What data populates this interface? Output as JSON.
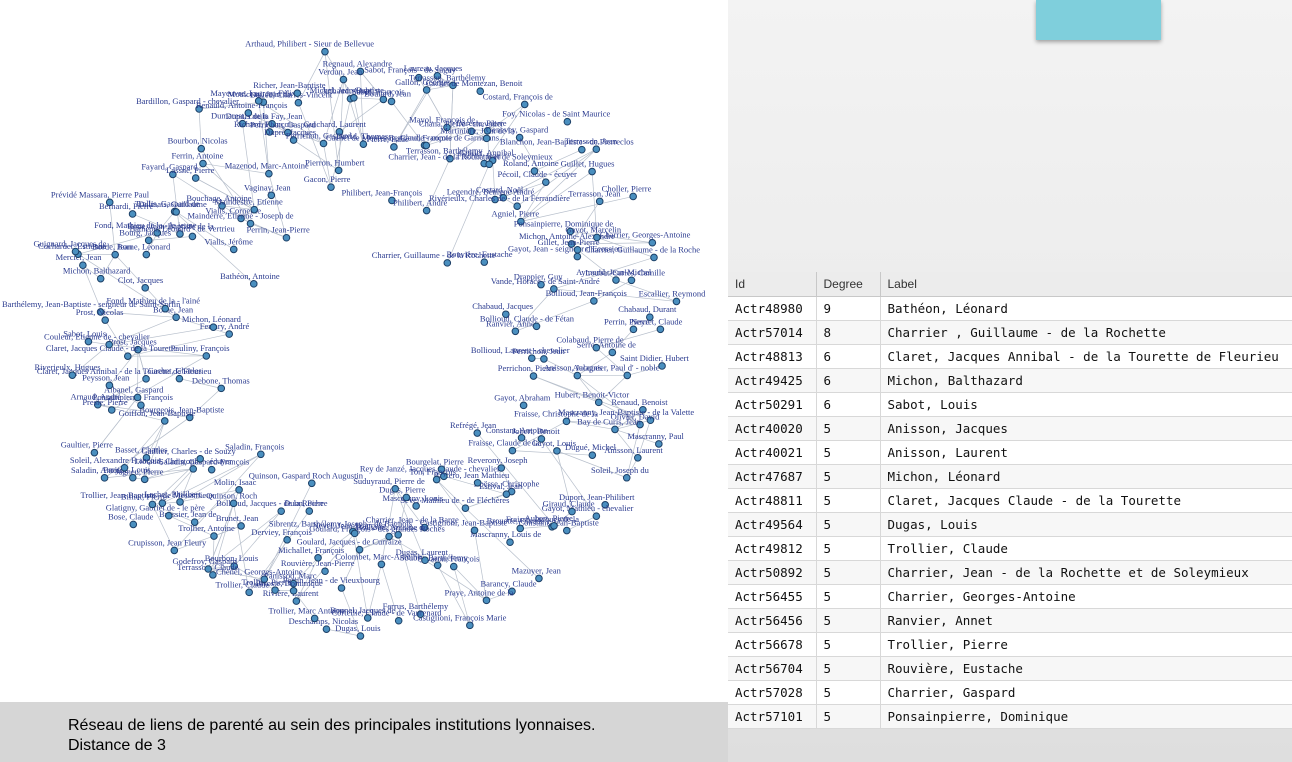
{
  "caption": {
    "line1": "Réseau de liens de parenté au sein des principales institutions lyonnaises.",
    "line2": "Distance de 3"
  },
  "table": {
    "headers": [
      "Id",
      "Degree",
      "Label"
    ],
    "rows": [
      [
        "Actr48980",
        "9",
        "Bathéon, Léonard"
      ],
      [
        "Actr57014",
        "8",
        "Charrier , Guillaume - de la Rochette"
      ],
      [
        "Actr48813",
        "6",
        "Claret, Jacques Annibal - de la Tourette de Fleurieu"
      ],
      [
        "Actr49425",
        "6",
        "Michon, Balthazard"
      ],
      [
        "Actr50291",
        "6",
        "Sabot, Louis"
      ],
      [
        "Actr40020",
        "5",
        "Anisson, Jacques"
      ],
      [
        "Actr40021",
        "5",
        "Anisson, Laurent"
      ],
      [
        "Actr47687",
        "5",
        "Michon, Léonard"
      ],
      [
        "Actr48811",
        "5",
        "Claret, Jacques Claude - de la Tourette"
      ],
      [
        "Actr49564",
        "5",
        "Dugas, Louis"
      ],
      [
        "Actr49812",
        "5",
        "Trollier, Claude"
      ],
      [
        "Actr50892",
        "5",
        "Charrier, Jean - de la Rochette et de Soleymieux"
      ],
      [
        "Actr56455",
        "5",
        "Charrier, Georges-Antoine"
      ],
      [
        "Actr56456",
        "5",
        "Ranvier, Annet"
      ],
      [
        "Actr56678",
        "5",
        "Trollier, Pierre"
      ],
      [
        "Actr56704",
        "5",
        "Rouvière, Eustache"
      ],
      [
        "Actr57028",
        "5",
        "Charrier, Gaspard"
      ],
      [
        "Actr57101",
        "5",
        "Ponsainpierre, Dominique"
      ]
    ]
  },
  "graph": {
    "node_labels": [
      "Regnaud, Alexandre",
      "Sabot, François",
      "Boulard, Jean",
      "Pierre, Isaac",
      "Philibert, Jean-François",
      "Sabot, François - de Sugny",
      "Gallon, Georges",
      "Laureau, Jacques",
      "Cachet de Montezan, Claude - comte de Garnerans",
      "Bertrand, François",
      "Terrasson, Barthélemy",
      "Mayol, François de",
      "Philibert, André",
      "Cachet de Montezan, Benoit",
      "Terrasson, Barthélemy",
      "Chana, Pierre - chevalier",
      "Martinière, Jean de la",
      "Dareste, Pierre",
      "Guillet, Annibal",
      "Fischer, Jean",
      "Costard, François de",
      "Charrier, Jean - de la Rochette et de Soleymieux",
      "Legendre, Bénigne André",
      "Genevey, Gaspard",
      "Foy, Nicolas - de Saint Maurice",
      "Costard, Noël",
      "Charrier, Guillaume - de la Rochette",
      "Pécoil, Claude - écuyer",
      "Rivérieulx, Charles de - de la Ferrandière",
      "Roland, Antoine",
      "Blanchon, Jean-Baptiste - de Pierreclos",
      "Terrasson, Jean",
      "Agniel, Pierre",
      "Guillet, Hugues",
      "Rouvière, Eustache",
      "Terrasson, Jean",
      "Choller, Pierre",
      "Ponsainpierre, Dominique de",
      "Michon, Antoine-Alexandre",
      "Gayot, Marcelin",
      "Gayot, Jean - seigneur d'Ecossieu",
      "Gillet, Jean-Pierre",
      "Charrier, Georges-Antoine",
      "Drappier, Guy",
      "Charrier, Guillaume - de la Roche",
      "Vande, Horace - de Saint-André",
      "Aymond, Jean-Michel",
      "Chabaud, Jacques",
      "Loubat-Carles, Camille",
      "Bollioud, Jean-François",
      "Escallier, Reymond",
      "Ranvier, Annet",
      "Chabaud, Durant",
      "Bollioud, Claude - de Fétan",
      "Neyret, Claude",
      "Perrin, Pierre",
      "Serre, Antoine de",
      "Colabaud, Pierre de",
      "Saint Didier, Hubert",
      "Perrichon, Jean",
      "Bollioud, Laurent - chevalier",
      "Aulagnier, Paul d' - noble",
      "Anisson, Jacques",
      "Perrichon, Pierre",
      "Renaud, Benoist",
      "Mascranny, Jean-Baptiste - de la Valette",
      "Hubert, Benoit-Victor",
      "Olivier, David",
      "Mascranny, Paul",
      "Bay de Curis, Jean",
      "Gayot, Abraham",
      "Anisson, Laurent",
      "Fraisse, Christophe de la",
      "Soleil, Joseph du",
      "Dugué, Michel",
      "Gayot, Louis",
      "Jobert, Benoit",
      "Duport, Jean-Philibert",
      "Fraisse, Claude de la",
      "Constant, Antoine",
      "Gayot, Mathieu - chevalier",
      "Giraud, Claude",
      "Refrégé, Jean",
      "Reverony, Joseph",
      "Fraisse, Jacques de la",
      "Constant, Jean-Baptiste",
      "Aubert, Pierre",
      "Boësse, Christophe",
      "Estival, Jean",
      "Brouette, Claude",
      "Bastero, Jean Mathieu",
      "Mascranny, Louis de",
      "Mazuyer, Jean",
      "Sève, Mathieu de - de Fléchères",
      "Rey de Janzé, Jacques Claude - chevalier",
      "Barancy, Claude",
      "Bourgelat, Pierre",
      "Castiglioni, Jean-Baptiste",
      "Ton, François",
      "Praye, Antoine de la",
      "Savaron, François",
      "Castiglioni, François Marie",
      "Charrier, Jean - de la Barge",
      "Soubry, Barthélemy",
      "Mascranny, Louis",
      "Dugas, Laurent",
      "Dugas, Pierre",
      "Suduyraud, Pierre de",
      "Ferrus, Barthélemy",
      "Goulard, François - des grandes Roches",
      "Bollioud, Antoine de",
      "Corteille, Claude - de Vaurenard",
      "Colombet, Marc-Antoine",
      "Bonnel, Jacques de",
      "Dugas, Louis",
      "Goulard, Jacques - de Curraize",
      "Sibrentz, Barthélemy-Joseph - de Bagnols",
      "Perrin, Jean - de Vieuxbourg",
      "Nevel, Jean-François",
      "Deschamps, Nicolas",
      "Trollier, Marc Antoine",
      "Rouvière, Jean-Pierre",
      "Michallet, François",
      "Rivière, Laurent",
      "Panissod, Marc",
      "Biroste, Dominique",
      "Duon, Pierre",
      "Trollier, Pierre",
      "Derviey, François",
      "Quinson, Gaspard Roch Augustin",
      "Chenel, Georges-Antoine",
      "Trollier, Claude",
      "Bollioud, Jacques - de la Roche",
      "Bourbon, Louis",
      "Terrasson, Claude",
      "Godefroy, Gaspard",
      "Quinson, Roch",
      "Brunet, Jean",
      "Trollier, Antoine",
      "Molin, Isaac",
      "Crupisson, Jean Fleury",
      "Brossier, Jean de",
      "Saladin, François",
      "Glatigny, Gabriel de - le père",
      "Lachet, Philibert",
      "Billiet, Pierre",
      "Bose, Claude",
      "Saladin, Gaspard-François",
      "Trollier, Jean-Baptiste - de Messimieux",
      "Liotaud, Christophe - écuyer",
      "Gaillier, Charles - de Souzy",
      "Jagneu, Pierre",
      "Parisot, Louis",
      "Saladin, Antoine",
      "Basset, Charles",
      "Soleil, Alexandre François",
      "Bourgeois, Jean-Baptiste",
      "Goiffon, Jean-Baptiste",
      "Gaultier, Pierre",
      "Debone, Thomas",
      "Ponsainpierre, François",
      "Arnaud, André",
      "Presle, Pierre",
      "Albanel, Gaspard",
      "Cachet, Charles",
      "Peysson, Jean",
      "Claret, Jacques Annibal - de la Tourette de Fleurieu",
      "Riverieulx, Hugues",
      "Pauliny, François",
      "Prost, Jacques",
      "Claret, Jacques Claude - de la Tourette",
      "Sabot, Louis",
      "Couleur, Etienne de - chevalier",
      "Ferrary, André",
      "Barthélemy, Jean-Baptiste - seigneur de Saint-Sorlin",
      "Prost, Nicolas",
      "Michon, Léonard",
      "Borne, Jean",
      "Fond, Mathieu de la - l'ainé",
      "Michon, Balthazard",
      "Clot, Jacques",
      "Mercier, Jean",
      "Cochardet, Estienne",
      "Guignard, Jacques de",
      "Borde, Jean",
      "Borne, Léonard",
      "Bourg, Jacques",
      "Fond, Mathieu de la - le jeune",
      "Bathéon, Antoine",
      "Prévidé Massara, Pierre Paul",
      "Bernardi, Pierre",
      "Roue, Jean-Baptiste de la",
      "Bathéon, Léonard - de Vertrieu",
      "Trallis, Gaspard de",
      "Dalmais, Guillaume",
      "Vialis, Jérôme",
      "Fayard, Gaspard",
      "Lassné, Pierre",
      "Bouchage, Antoine",
      "Vialis, Corneille",
      "Bourbon, Nicolas",
      "Mainderre, Etienne - Joseph de",
      "Ferrin, Antoine",
      "Maindestre, Etienne",
      "Perrin, Jean-Pierre",
      "Vaginay, Jean",
      "Bardillon, Gaspard - chevalier",
      "Dumarest, Louis",
      "Mazenod, Marc-Antoine",
      "Renauld, Antoine-François",
      "Richard, François",
      "Moulceau, Jean de",
      "Mayeuvre, Laurent-Félix",
      "Dupuis de la Fay, Jean",
      "Dupré, Jacques",
      "Perrichon, Gaspard",
      "Dalieu, Charles-Vincent",
      "Richer, Jean-Baptiste",
      "Perrichon, Gaspard",
      "Gacon, Pierre",
      "Pierron, Humbert",
      "Arthaud, Philibert - Sieur de Bellevue",
      "Verdun, Jean",
      "Guichard, Laurent",
      "Arthaud, André",
      "David, Thomas",
      "Michel, Jean-Baptiste"
    ]
  }
}
